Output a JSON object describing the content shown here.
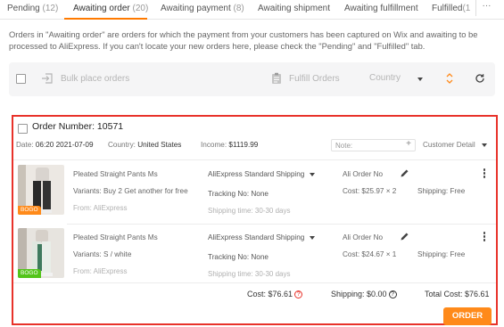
{
  "tabs": [
    {
      "label": "Pending",
      "count": "(12)"
    },
    {
      "label": "Awaiting order",
      "count": "(20)"
    },
    {
      "label": "Awaiting payment",
      "count": "(8)"
    },
    {
      "label": "Awaiting shipment",
      "count": ""
    },
    {
      "label": "Awaiting fulfillment",
      "count": ""
    },
    {
      "label": "Fulfilled",
      "count": "(1"
    }
  ],
  "tabs_more": "···",
  "info_text": "Orders in \"Awaiting order\" are orders for which the payment from your customers has been captured on Wix and awaiting to be processed to AliExpress. If you can't locate your new orders here, please check the \"Pending\" and \"Fulfilled\" tab.",
  "toolbar": {
    "bulk_label": "Bulk place orders",
    "fulfill_label": "Fulfill Orders",
    "country_label": "Country"
  },
  "order": {
    "number_label": "Order Number: 10571",
    "date_label": "Date:",
    "date_value": "06:20 2021-07-09",
    "country_label": "Country:",
    "country_value": "United States",
    "income_label": "Income:",
    "income_value": "$1119.99",
    "note_placeholder": "Note:",
    "customer_detail": "Customer Detail",
    "items": [
      {
        "name": "Pleated Straight Pants Ms",
        "variant": "Variants: Buy 2 Get another for free",
        "from": "From: AliExpress",
        "badge": "BOGO",
        "shipping_method": "AliExpress Standard Shipping",
        "tracking": "Tracking No: None",
        "shipping_time": "Shipping time: 30-30 days",
        "ali_order": "Ali Order No",
        "cost": "Cost: $25.97 × 2",
        "shipping_fee": "Shipping: Free"
      },
      {
        "name": "Pleated Straight Pants Ms",
        "variant": "Variants: S / white",
        "from": "From: AliExpress",
        "badge": "BOGO",
        "shipping_method": "AliExpress Standard Shipping",
        "tracking": "Tracking No: None",
        "shipping_time": "Shipping time: 30-30 days",
        "ali_order": "Ali Order No",
        "cost": "Cost: $24.67 × 1",
        "shipping_fee": "Shipping: Free"
      }
    ],
    "total_cost": "Cost: $76.61",
    "total_shipping": "Shipping: $0.00",
    "grand_total": "Total Cost: $76.61",
    "order_button": "ORDER"
  },
  "colors": {
    "accent": "#ff7a00",
    "order_button": "#ff8a1a",
    "highlight_border": "#e8322a",
    "badge_orange": "#ff8a1a",
    "badge_green": "#52c41a"
  },
  "icons": [
    "checkbox-icon",
    "import-icon",
    "clipboard-icon",
    "dropdown-caret-icon",
    "sort-icon",
    "refresh-icon",
    "plus-icon",
    "pencil-icon",
    "more-vertical-icon",
    "question-circle-icon",
    "help-circle-icon"
  ]
}
